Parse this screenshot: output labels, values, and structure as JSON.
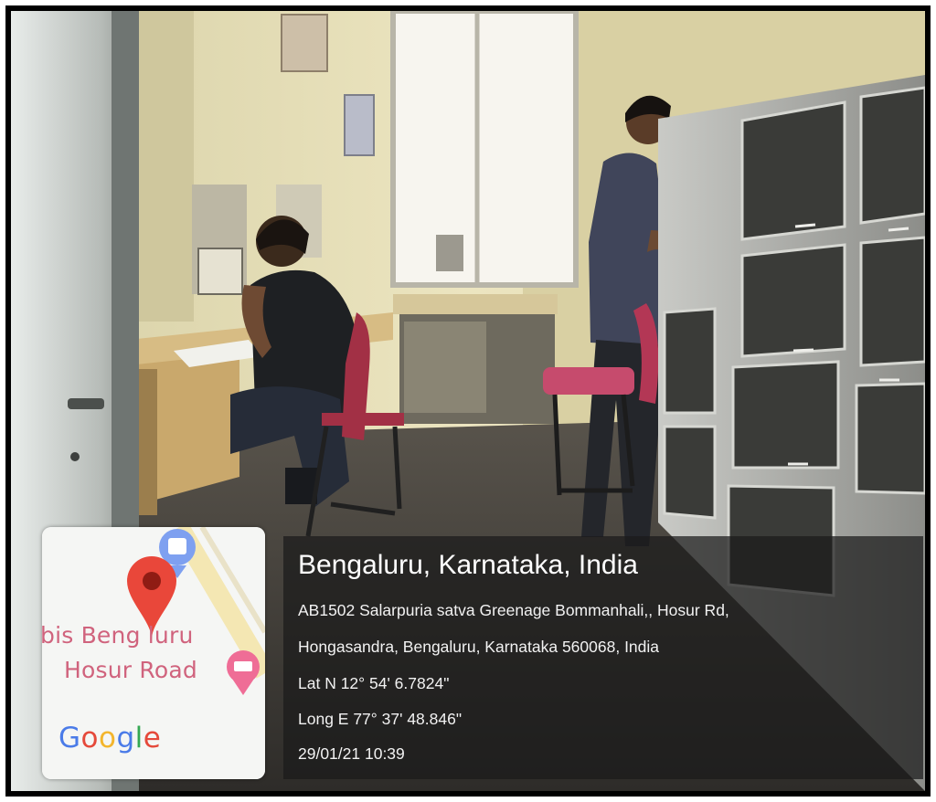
{
  "location": {
    "title": "Bengaluru, Karnataka, India",
    "address_line1": "AB1502 Salarpuria satva Greenage Bommanhali,, Hosur Rd,",
    "address_line2": "Hongasandra, Bengaluru, Karnataka 560068, India",
    "latitude": "Lat N 12° 54' 6.7824\"",
    "longitude": "Long E 77° 37' 48.846\"",
    "datetime": "29/01/21 10:39"
  },
  "map": {
    "place_label_line1": "bis Beng luru",
    "place_label_line2": "Hosur Road",
    "logo_letters": [
      "G",
      "o",
      "o",
      "g",
      "l",
      "e"
    ],
    "logo_colors": [
      "#4a7be8",
      "#e5493a",
      "#f3b52c",
      "#4a7be8",
      "#34a853",
      "#e5493a"
    ],
    "pin_color": "#e9473a",
    "label_color": "#d0637d"
  }
}
